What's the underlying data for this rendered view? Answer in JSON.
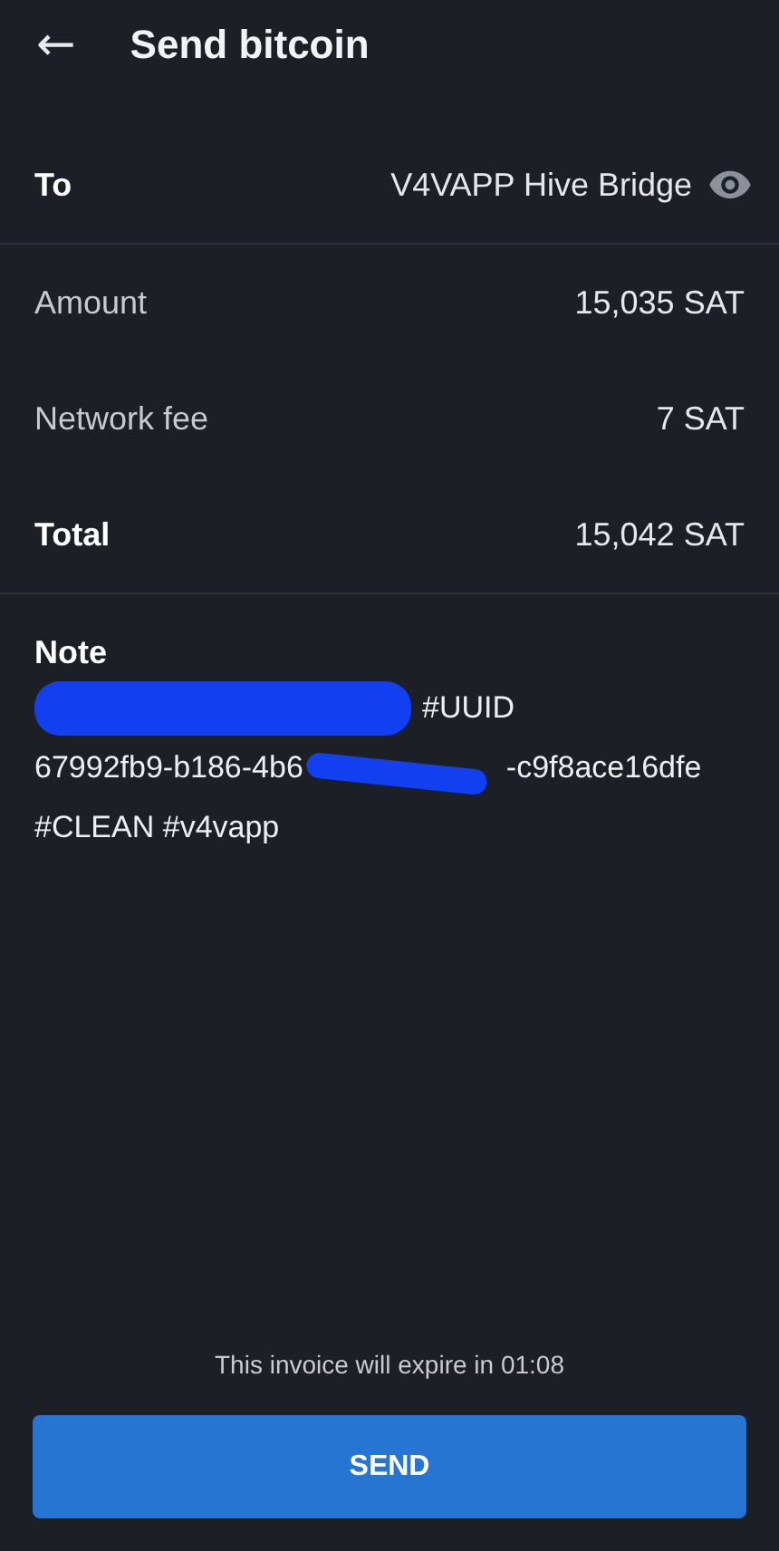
{
  "header": {
    "back": "←",
    "title": "Send bitcoin"
  },
  "recipient": {
    "label": "To",
    "value": "V4VAPP Hive Bridge"
  },
  "summary": [
    {
      "label": "Amount",
      "value": "15,035 SAT",
      "kind": "normal"
    },
    {
      "label": "Network fee",
      "value": "7 SAT",
      "kind": "normal"
    },
    {
      "label": "Total",
      "value": "15,042 SAT",
      "kind": "total"
    }
  ],
  "note": {
    "label": "Note",
    "lines": [
      [
        {
          "kind": "redacted"
        },
        {
          "kind": "text",
          "text": "#UUID"
        }
      ],
      [
        {
          "kind": "text",
          "text": "67992fb9-b186-4b6"
        },
        {
          "kind": "redacted"
        },
        {
          "kind": "text",
          "text": "-c9f8ace16dfe"
        }
      ],
      [
        {
          "kind": "text",
          "text": "#CLEAN #v4vapp"
        }
      ]
    ]
  },
  "expiry": "This invoice will expire in 01:08",
  "button": "SEND"
}
